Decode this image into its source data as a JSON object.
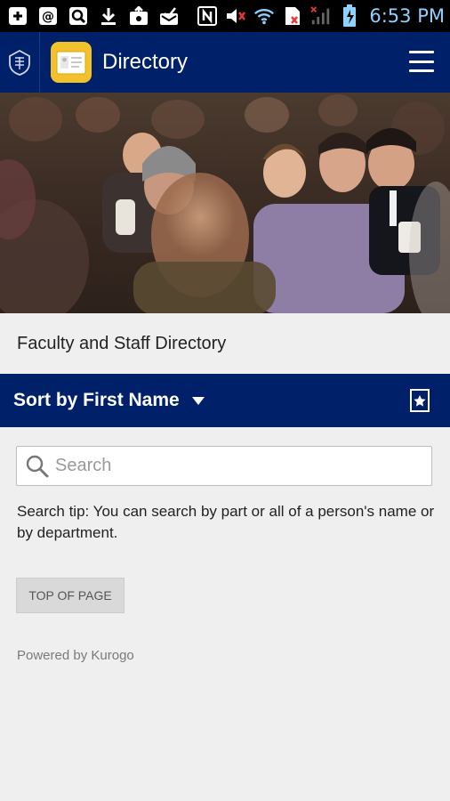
{
  "status_bar": {
    "time": "6:53 PM",
    "icons": [
      "add-box-icon",
      "at-sign-icon",
      "screenshot-icon",
      "download-icon",
      "photo-upload-icon",
      "mail-check-icon",
      "nfc-icon",
      "muted-volume-icon",
      "wifi-icon",
      "no-sim-icon",
      "signal-icon",
      "battery-charging-icon"
    ],
    "clock_color": "#8fd0ff"
  },
  "app_bar": {
    "title": "Directory",
    "background": "#002169",
    "module_icon_color": "#f2c12e"
  },
  "hero": {
    "description_icon": "audience-photo"
  },
  "page": {
    "heading": "Faculty and Staff Directory"
  },
  "sort_bar": {
    "label": "Sort by First Name",
    "background": "#002169"
  },
  "search": {
    "placeholder": "Search",
    "value": ""
  },
  "search_tip": "Search tip: You can search by part or all of a person's name or by department.",
  "top_of_page_label": "TOP OF PAGE",
  "powered_by": "Powered by Kurogo"
}
